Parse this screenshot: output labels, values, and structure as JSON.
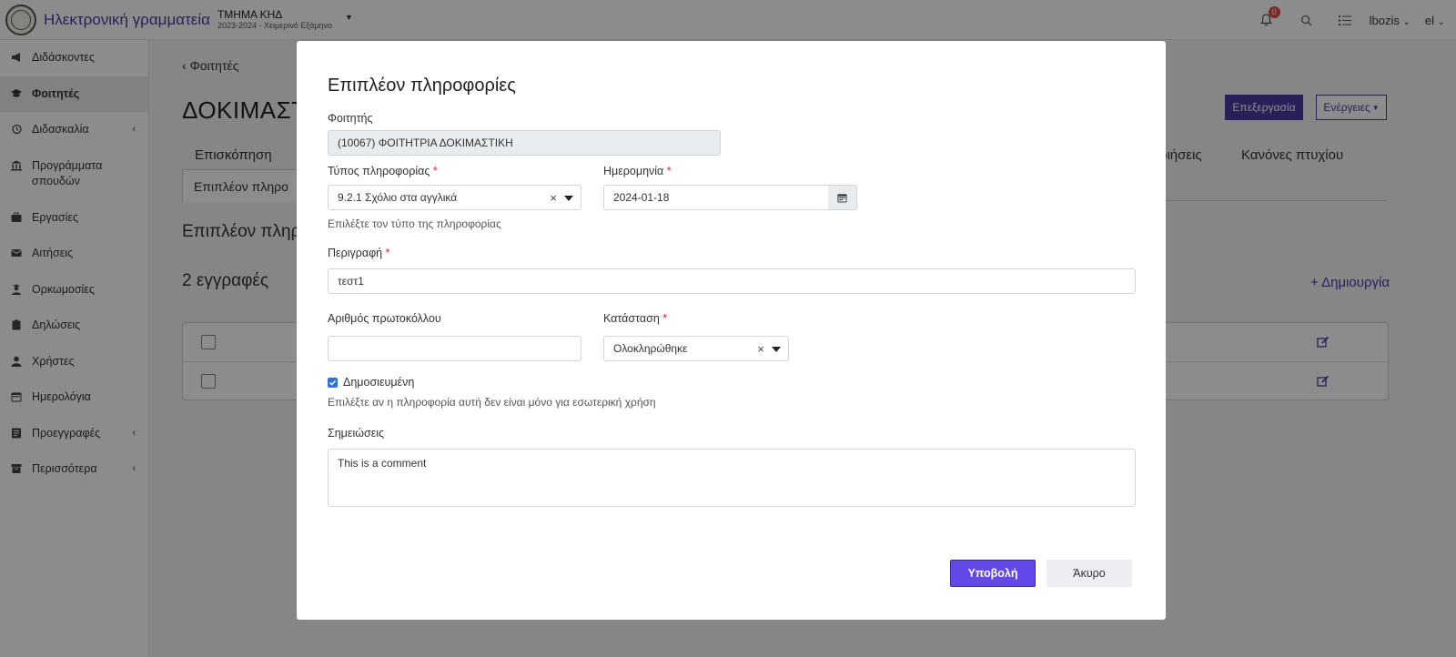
{
  "header": {
    "app_title": "Ηλεκτρονική γραμματεία",
    "department": "ΤΜΗΜΑ ΚΗΔ",
    "period": "2023-2024 - Χειμερινό Εξάμηνο",
    "notifications_count": "0",
    "user": "lbozis",
    "language": "el"
  },
  "sidebar": {
    "items": [
      {
        "label": "Διδάσκοντες",
        "icon": "megaphone-icon"
      },
      {
        "label": "Φοιτητές",
        "icon": "graduation-cap-icon",
        "active": true
      },
      {
        "label": "Διδασκαλία",
        "icon": "history-icon",
        "chevron": "‹"
      },
      {
        "label": "Προγράμματα σπουδών",
        "icon": "institution-icon"
      },
      {
        "label": "Εργασίες",
        "icon": "briefcase-icon"
      },
      {
        "label": "Αιτήσεις",
        "icon": "envelope-icon"
      },
      {
        "label": "Ορκωμοσίες",
        "icon": "user-graduate-icon"
      },
      {
        "label": "Δηλώσεις",
        "icon": "clipboard-icon"
      },
      {
        "label": "Χρήστες",
        "icon": "user-icon"
      },
      {
        "label": "Ημερολόγια",
        "icon": "calendar-icon"
      },
      {
        "label": "Προεγγραφές",
        "icon": "id-card-icon",
        "chevron": "‹"
      },
      {
        "label": "Περισσότερα",
        "icon": "archive-icon",
        "chevron": "‹"
      }
    ]
  },
  "page": {
    "back_label": "Φοιτητές",
    "title": "ΔΟΚΙΜΑΣΤ",
    "edit_button": "Επεξεργασία",
    "actions_button": "Ενέργειες",
    "tabs": {
      "overview": "Επισκόπηση",
      "attendances": "ποιήσεις",
      "degree_rules": "Κανόνες πτυχίου"
    },
    "subtab": "Επιπλέον πληρο",
    "section_title": "Επιπλέον πληρ",
    "records_count": "2 εγγραφές",
    "create_link": "+ Δημιουργία"
  },
  "modal": {
    "title": "Επιπλέον πληροφορίες",
    "student_label": "Φοιτητής",
    "student_value": "(10067) ΦΟΙΤΗΤΡΙΑ ΔΟΚΙΜΑΣΤΙΚΗ",
    "type_label": "Τύπος πληροφορίας",
    "type_value": "9.2.1 Σχόλιο στα αγγλικά",
    "type_help": "Επιλέξτε τον τύπο της πληροφορίας",
    "date_label": "Ημερομηνία",
    "date_value": "2024-01-18",
    "description_label": "Περιγραφή",
    "description_value": "τεστ1",
    "protocol_label": "Αριθμός πρωτοκόλλου",
    "protocol_value": "",
    "status_label": "Κατάσταση",
    "status_value": "Ολοκληρώθηκε",
    "published_label": "Δημοσιευμένη",
    "published_checked": true,
    "published_help": "Επιλέξτε αν η πληροφορία αυτή δεν είναι μόνο για εσωτερική χρήση",
    "notes_label": "Σημειώσεις",
    "notes_value": "This is a comment",
    "required_mark": "*",
    "clear_mark": "×",
    "submit_button": "Υποβολή",
    "cancel_button": "Άκυρο"
  },
  "colors": {
    "brand": "#4b3ba3",
    "submit": "#6347e8",
    "required": "#dd2233",
    "checkbox": "#2f6fe0"
  }
}
